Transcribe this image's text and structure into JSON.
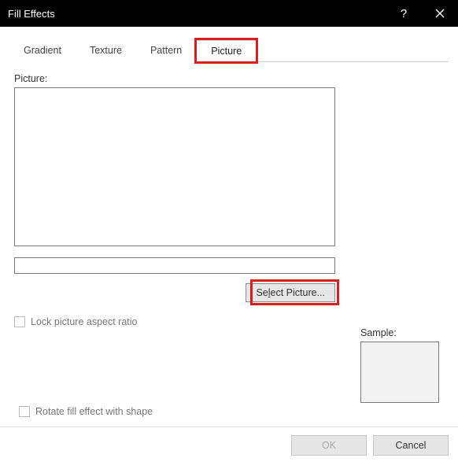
{
  "titlebar": {
    "title": "Fill Effects"
  },
  "tabs": {
    "gradient": "Gradient",
    "texture": "Texture",
    "pattern": "Pattern",
    "picture": "Picture"
  },
  "picture_panel": {
    "label": "Picture:",
    "filename": "",
    "select_button_pre": "Se",
    "select_button_u": "l",
    "select_button_post": "ect Picture...",
    "lock_aspect": "Lock picture aspect ratio",
    "sample_label": "Sample:",
    "rotate_label": "Rotate fill effect with shape"
  },
  "footer": {
    "ok": "OK",
    "cancel": "Cancel"
  }
}
